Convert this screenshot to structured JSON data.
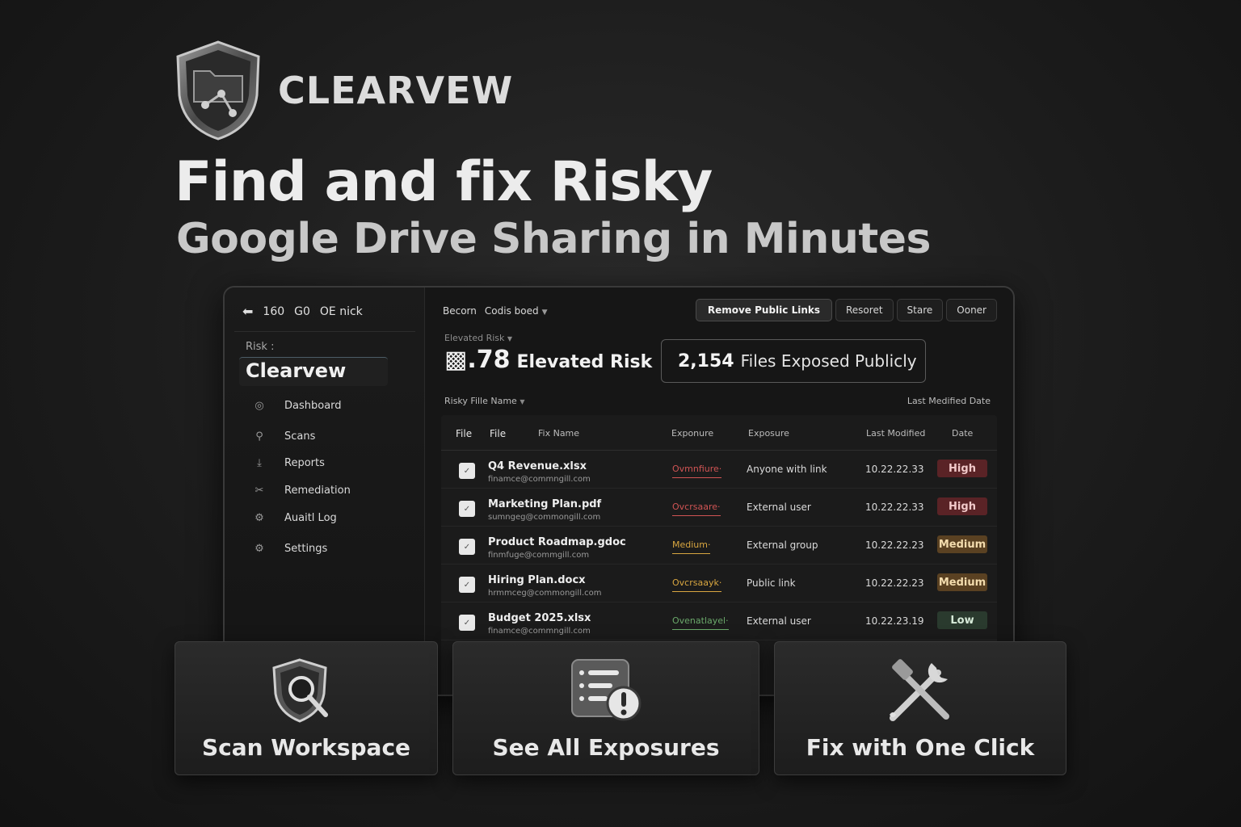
{
  "brand": {
    "name": "CLEARVEW"
  },
  "hero": {
    "headline": "Find and fix Risky",
    "subheadline": "Google Drive Sharing in Minutes"
  },
  "app": {
    "sidebar": {
      "top": {
        "back": "⬅",
        "item1": "160",
        "item2": "G0",
        "item3": "OE nick"
      },
      "risk_label": "Risk :",
      "brand_label": "Clearvew",
      "nav": [
        {
          "label": "Dashboard",
          "icon": "dashboard-icon"
        },
        {
          "label": "Scans",
          "icon": "search-icon"
        },
        {
          "label": "Reports",
          "icon": "reports-icon"
        },
        {
          "label": "Remediation",
          "icon": "tools-icon"
        },
        {
          "label": "Auaitl Log",
          "icon": "gear-icon"
        },
        {
          "label": "Settings",
          "icon": "settings-icon"
        }
      ]
    },
    "topbar": {
      "crumb1": "Becorn",
      "crumb2": "Codis boed",
      "actions": {
        "primary": "Remove Public Links",
        "a2": "Resoret",
        "a3": "Stare",
        "a4": "Ooner"
      }
    },
    "summary": {
      "elevated_label": "Elevated Risk",
      "elevated_num": "▩.78",
      "elevated_text": "Elevated Risk",
      "exposed_num": "2,154",
      "exposed_text": "Files Exposed Publicly"
    },
    "filters": {
      "left": "Risky Fille Name",
      "right": "Last Medified Date"
    },
    "table": {
      "headers": {
        "c1": "File",
        "c2": "File",
        "c3": "Fix Name",
        "c4": "Exponure",
        "c5": "Exposure",
        "c6": "Last Modified",
        "c7": "Date"
      },
      "rows": [
        {
          "name": "Q4 Revenue.xlsx",
          "owner": "finamce@commngill.com",
          "severity": "Ovmnfiure·",
          "sev_color": "#d05454",
          "exposure": "Anyone with link",
          "modified": "10.22.22.33",
          "risk": "High",
          "badge_bg": "#5a2326",
          "badge_fg": "#f1c9c9"
        },
        {
          "name": "Marketing Plan.pdf",
          "owner": "sumngeg@commongill.com",
          "severity": "Ovcrsaare·",
          "sev_color": "#d05454",
          "exposure": "External user",
          "modified": "10.22.22.33",
          "risk": "High",
          "badge_bg": "#5a2326",
          "badge_fg": "#f1c9c9"
        },
        {
          "name": "Product Roadmap.gdoc",
          "owner": "finmfuge@commgill.com",
          "severity": "Medium·",
          "sev_color": "#d8a640",
          "exposure": "External group",
          "modified": "10.22.22.23",
          "risk": "Medium",
          "badge_bg": "#5a4122",
          "badge_fg": "#f3dcae"
        },
        {
          "name": "Hiring Plan.docx",
          "owner": "hrmmceg@commongill.com",
          "severity": "Ovcrsaayk·",
          "sev_color": "#d8a640",
          "exposure": "Public link",
          "modified": "10.22.22.23",
          "risk": "Medium",
          "badge_bg": "#5a4122",
          "badge_fg": "#f3dcae"
        },
        {
          "name": "Budget 2025.xlsx",
          "owner": "finamce@commngill.com",
          "severity": "Ovenatlayel·",
          "sev_color": "#6aa86a",
          "exposure": "External user",
          "modified": "10.22.23.19",
          "risk": "Low",
          "badge_bg": "#2a3a2e",
          "badge_fg": "#d6ead8"
        }
      ]
    }
  },
  "features": [
    {
      "label": "Scan Workspace",
      "icon": "shield-search-icon"
    },
    {
      "label": "See All Exposures",
      "icon": "list-alert-icon"
    },
    {
      "label": "Fix with One Click",
      "icon": "tools-icon"
    }
  ]
}
